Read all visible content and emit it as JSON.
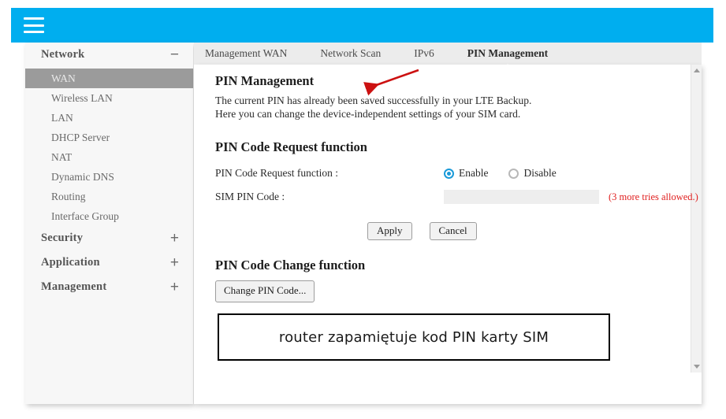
{
  "header": {
    "menu_icon": "hamburger-icon",
    "background_color": "#00aeef"
  },
  "sidebar": {
    "groups": [
      {
        "label": "Network",
        "sign": "−",
        "expanded": true,
        "items": [
          {
            "label": "WAN",
            "active": true
          },
          {
            "label": "Wireless LAN",
            "active": false
          },
          {
            "label": "LAN",
            "active": false
          },
          {
            "label": "DHCP Server",
            "active": false
          },
          {
            "label": "NAT",
            "active": false
          },
          {
            "label": "Dynamic DNS",
            "active": false
          },
          {
            "label": "Routing",
            "active": false
          },
          {
            "label": "Interface Group",
            "active": false
          }
        ]
      },
      {
        "label": "Security",
        "sign": "+",
        "expanded": false,
        "items": []
      },
      {
        "label": "Application",
        "sign": "+",
        "expanded": false,
        "items": []
      },
      {
        "label": "Management",
        "sign": "+",
        "expanded": false,
        "items": []
      }
    ],
    "active_item_bg": "#9b9b9b"
  },
  "tabs": [
    {
      "label": "Management WAN",
      "active": false
    },
    {
      "label": "Network Scan",
      "active": false
    },
    {
      "label": "IPv6",
      "active": false
    },
    {
      "label": "PIN Management",
      "active": true
    }
  ],
  "main": {
    "title": "PIN Management",
    "description_line1": "The current PIN has already been saved successfully in your LTE Backup.",
    "description_line2": "Here you can change the device-independent settings of your SIM card.",
    "request_section": {
      "title": "PIN Code Request function",
      "field_label": "PIN Code Request function :",
      "options": [
        {
          "label": "Enable",
          "selected": true
        },
        {
          "label": "Disable",
          "selected": false
        }
      ],
      "pin_label": "SIM PIN Code :",
      "pin_value": "",
      "pin_placeholder": "",
      "tries_text": "(3 more tries allowed.)",
      "tries_color": "#e02020",
      "apply_label": "Apply",
      "cancel_label": "Cancel"
    },
    "change_section": {
      "title": "PIN Code Change function",
      "button_label": "Change PIN Code..."
    },
    "callout": {
      "text": "router zapamiętuje kod PIN karty SIM"
    },
    "annotation": {
      "shape": "red-arrow",
      "color": "#cc1111"
    }
  },
  "scrollbar": {
    "up_icon": "triangle-up-icon",
    "down_icon": "triangle-down-icon"
  }
}
